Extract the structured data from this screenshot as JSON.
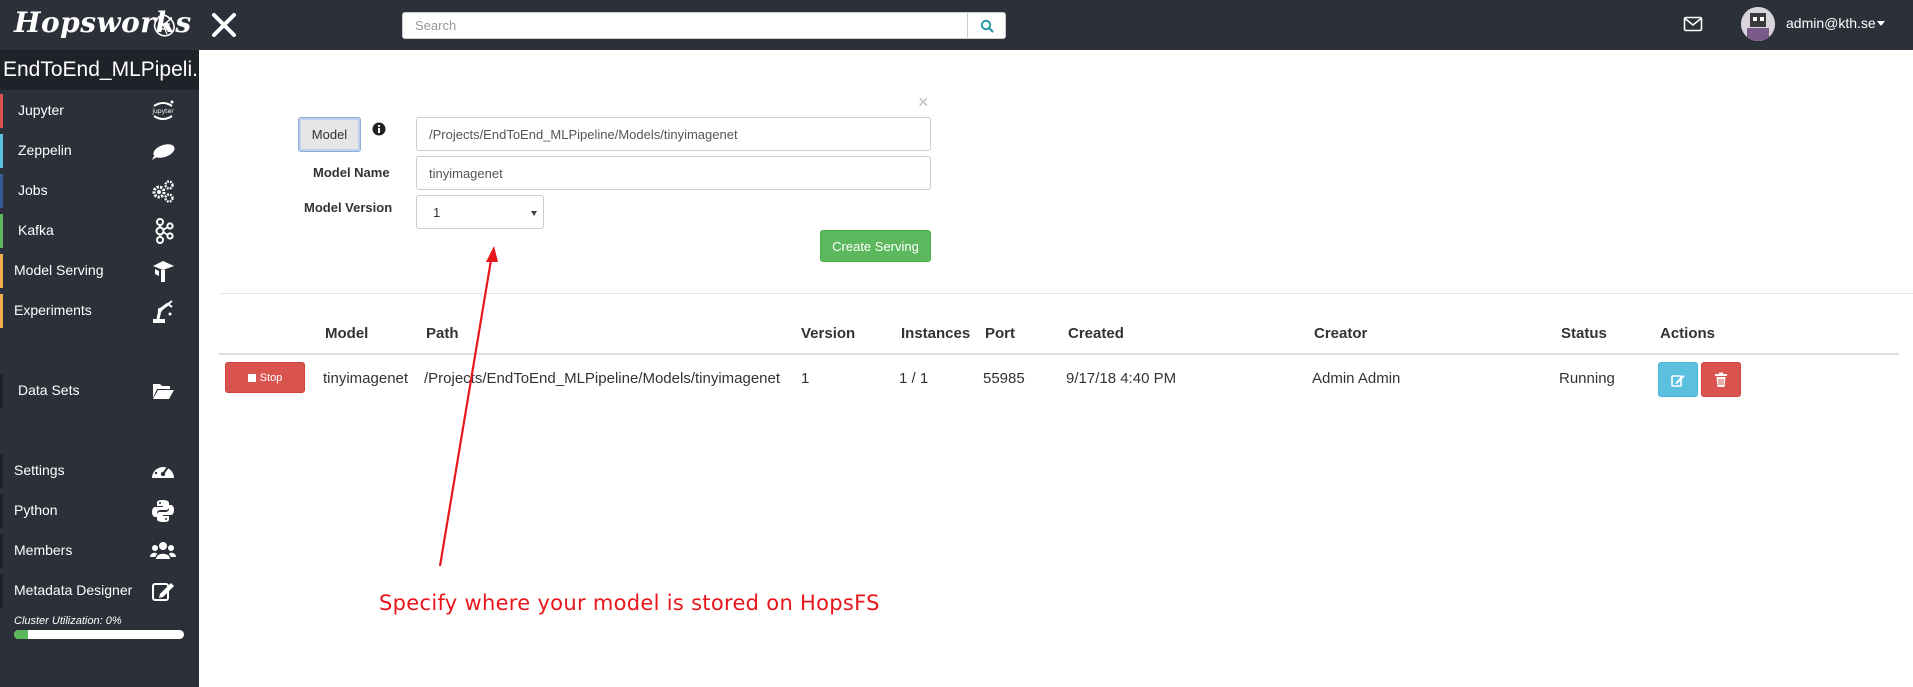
{
  "topbar": {
    "logo": "Hopsworks",
    "search_placeholder": "Search",
    "user": "admin@kth.se"
  },
  "sidebar": {
    "project": "EndToEnd_MLPipeli...",
    "items": [
      {
        "label": "Jupyter",
        "color": "#d9534f",
        "icon": "jupyter-icon"
      },
      {
        "label": "Zeppelin",
        "color": "#5bc0de",
        "icon": "zeppelin-icon"
      },
      {
        "label": "Jobs",
        "color": "#3b5998",
        "icon": "gears-icon"
      },
      {
        "label": "Kafka",
        "color": "#5cb85c",
        "icon": "kafka-icon"
      },
      {
        "label": "Model Serving",
        "color": "#f0ad4e",
        "icon": "serving-icon"
      },
      {
        "label": "Experiments",
        "color": "#f0ad4e",
        "icon": "robot-arm-icon"
      },
      {
        "label": "Data Sets",
        "color": "#2c3038",
        "icon": "folder-open-icon"
      },
      {
        "label": "Settings",
        "color": "#2c3038",
        "icon": "dashboard-icon"
      },
      {
        "label": "Python",
        "color": "#2c3038",
        "icon": "python-icon"
      },
      {
        "label": "Members",
        "color": "#2c3038",
        "icon": "users-icon"
      },
      {
        "label": "Metadata Designer",
        "color": "#2c3038",
        "icon": "edit-icon"
      }
    ],
    "cluster_label": "Cluster Utilization: 0%",
    "cluster_utilization": 0.08
  },
  "form": {
    "model_button": "Model",
    "model_path": "/Projects/EndToEnd_MLPipeline/Models/tinyimagenet",
    "model_name_label": "Model Name",
    "model_name": "tinyimagenet",
    "model_version_label": "Model Version",
    "model_version": "1",
    "create_button": "Create Serving",
    "close": "×"
  },
  "table": {
    "headers": [
      "Model",
      "Path",
      "Version",
      "Instances",
      "Port",
      "Created",
      "Creator",
      "Status",
      "Actions"
    ],
    "rows": [
      {
        "stop_label": "Stop",
        "model": "tinyimagenet",
        "path": "/Projects/EndToEnd_MLPipeline/Models/tinyimagenet",
        "version": "1",
        "instances": "1 / 1",
        "port": "55985",
        "created": "9/17/18 4:40 PM",
        "creator": "Admin Admin",
        "status": "Running"
      }
    ]
  },
  "annotation": {
    "text": "Specify where your model is stored on HopsFS",
    "color": "#e8151b"
  }
}
